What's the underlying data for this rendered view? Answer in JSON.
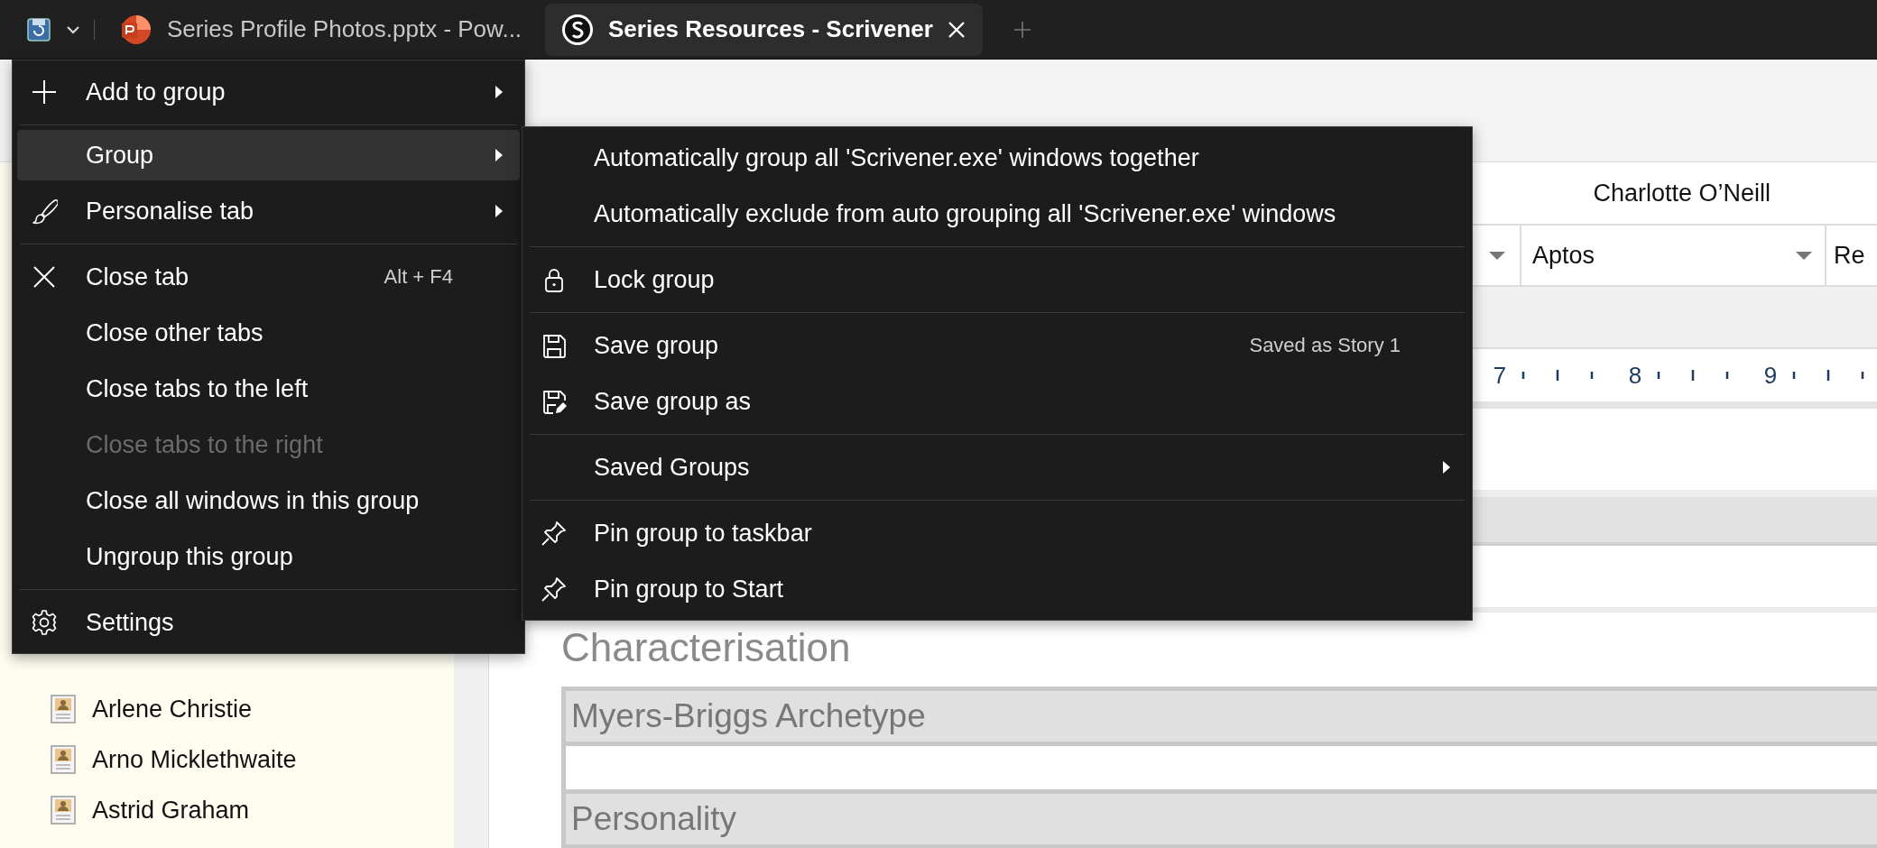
{
  "tab_bar": {
    "tabs": [
      {
        "title": "Series Profile Photos.pptx - Pow...",
        "selected": false
      },
      {
        "title": "Series Resources - Scrivener",
        "selected": true
      }
    ]
  },
  "binder": {
    "items": [
      {
        "title": "Arlene Christie"
      },
      {
        "title": "Arno Micklethwaite"
      },
      {
        "title": "Astrid Graham"
      }
    ]
  },
  "editor": {
    "document_title": "Charlotte O’Neill",
    "font_name": "Aptos",
    "font_style": "Re",
    "ruler": [
      "7",
      "8",
      "9"
    ],
    "heading": "Characterisation",
    "table_rows": [
      {
        "label": "Myers-Briggs Archetype"
      },
      {
        "label": "Personality"
      }
    ]
  },
  "context_menu": {
    "sections": [
      {
        "items": [
          {
            "label": "Add to group",
            "has_submenu": true,
            "selected": false,
            "disabled": false
          }
        ]
      },
      {
        "items": [
          {
            "label": "Group",
            "has_submenu": true,
            "selected": true,
            "disabled": false
          },
          {
            "label": "Personalise tab",
            "has_submenu": true,
            "selected": false,
            "disabled": false
          }
        ]
      },
      {
        "items": [
          {
            "label": "Close tab",
            "shortcut": "Alt + F4",
            "has_submenu": false,
            "selected": false,
            "disabled": false
          },
          {
            "label": "Close other tabs",
            "has_submenu": false,
            "selected": false,
            "disabled": false
          },
          {
            "label": "Close tabs to the left",
            "has_submenu": false,
            "selected": false,
            "disabled": false
          },
          {
            "label": "Close tabs to the right",
            "has_submenu": false,
            "selected": false,
            "disabled": true
          },
          {
            "label": "Close all windows in this group",
            "has_submenu": false,
            "selected": false,
            "disabled": false
          },
          {
            "label": "Ungroup this group",
            "has_submenu": false,
            "selected": false,
            "disabled": false
          }
        ]
      },
      {
        "items": [
          {
            "label": "Settings",
            "has_submenu": false,
            "selected": false,
            "disabled": false
          }
        ]
      }
    ]
  },
  "group_submenu": {
    "sections": [
      {
        "items": [
          {
            "label": "Automatically group all 'Scrivener.exe' windows together",
            "has_submenu": false,
            "selected": false,
            "disabled": false
          },
          {
            "label": "Automatically exclude from auto grouping all 'Scrivener.exe' windows",
            "has_submenu": false,
            "selected": false,
            "disabled": false
          }
        ]
      },
      {
        "items": [
          {
            "label": "Lock group",
            "has_submenu": false,
            "selected": false,
            "disabled": false
          }
        ]
      },
      {
        "items": [
          {
            "label": "Save group",
            "shortcut": "Saved as Story 1",
            "has_submenu": false,
            "selected": false,
            "disabled": false
          },
          {
            "label": "Save group as",
            "has_submenu": false,
            "selected": false,
            "disabled": false
          }
        ]
      },
      {
        "items": [
          {
            "label": "Saved Groups",
            "has_submenu": true,
            "selected": false,
            "disabled": false
          }
        ]
      },
      {
        "items": [
          {
            "label": "Pin group to taskbar",
            "has_submenu": false,
            "selected": false,
            "disabled": false
          },
          {
            "label": "Pin group to Start",
            "has_submenu": false,
            "selected": false,
            "disabled": false
          }
        ]
      }
    ]
  }
}
